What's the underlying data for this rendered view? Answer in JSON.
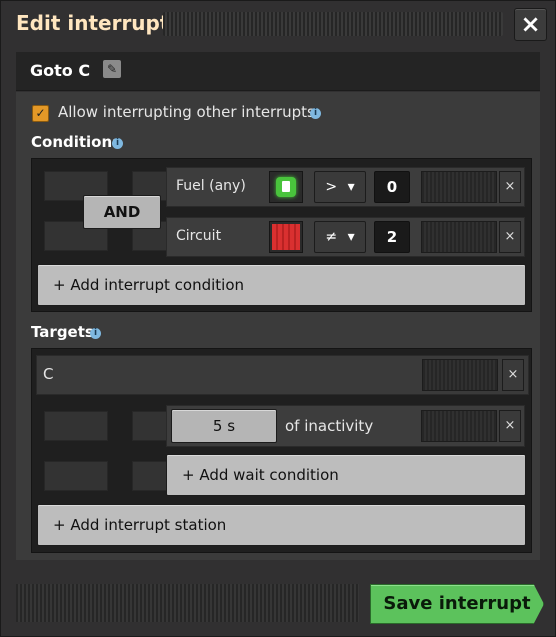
{
  "window": {
    "title": "Edit interrupt",
    "close_label": "×"
  },
  "interrupt": {
    "name": "Goto C",
    "edit_label": "✎"
  },
  "options": {
    "allow_interrupting_label": "Allow interrupting other interrupts",
    "allow_interrupting_checked": true
  },
  "conditions": {
    "title": "Conditions",
    "logic_label": "AND",
    "rows": [
      {
        "label": "Fuel (any)",
        "signal_icon": "fuel-icon",
        "operator": ">",
        "value": "0",
        "remove_label": "×"
      },
      {
        "label": "Circuit",
        "signal_icon": "red-signal-icon",
        "operator": "≠",
        "value": "2",
        "remove_label": "×"
      }
    ],
    "add_label": "+ Add interrupt condition"
  },
  "targets": {
    "title": "Targets",
    "station": "C",
    "station_remove_label": "×",
    "wait": {
      "time": "5 s",
      "label": "of inactivity",
      "remove_label": "×"
    },
    "add_wait_label": "+ Add wait condition",
    "add_station_label": "+ Add interrupt station"
  },
  "footer": {
    "save_label": "Save interrupt"
  },
  "colors": {
    "accent": "#e39827",
    "save_green": "#5cc25c",
    "signal_red": "#d93030",
    "fuel_green": "#49c43c"
  }
}
